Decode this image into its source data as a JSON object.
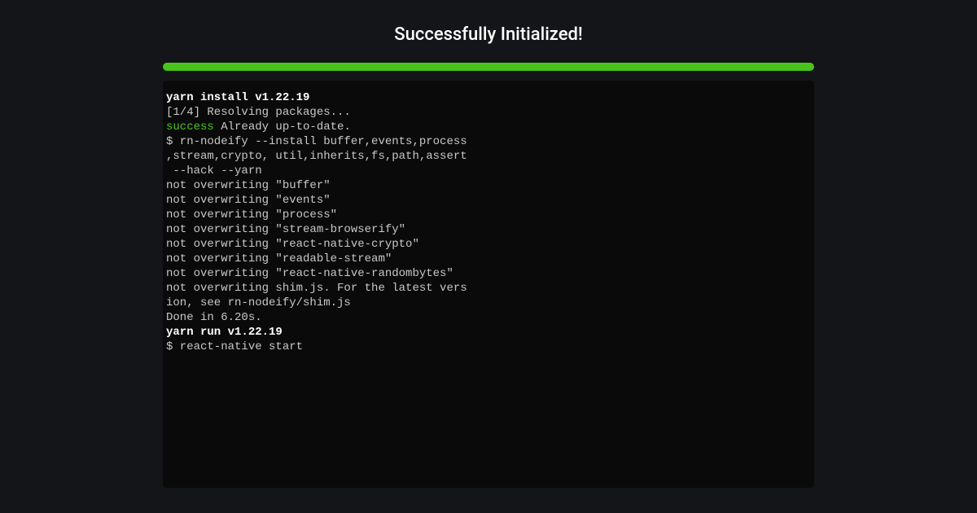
{
  "heading": "Successfully Initialized!",
  "progress": {
    "percent": 100,
    "color": "#4ac41c"
  },
  "terminal": {
    "lines": [
      {
        "segments": [
          {
            "text": "yarn install v1.22.19",
            "style": "bold"
          }
        ]
      },
      {
        "segments": [
          {
            "text": "[1/4] Resolving packages...",
            "style": ""
          }
        ]
      },
      {
        "segments": [
          {
            "text": "success",
            "style": "success"
          },
          {
            "text": " Already up-to-date.",
            "style": ""
          }
        ]
      },
      {
        "segments": [
          {
            "text": "$ rn-nodeify --install buffer,events,process",
            "style": ""
          }
        ]
      },
      {
        "segments": [
          {
            "text": ",stream,crypto, util,inherits,fs,path,assert",
            "style": ""
          }
        ]
      },
      {
        "segments": [
          {
            "text": " --hack --yarn",
            "style": ""
          }
        ]
      },
      {
        "segments": [
          {
            "text": "not overwriting \"buffer\"",
            "style": ""
          }
        ]
      },
      {
        "segments": [
          {
            "text": "not overwriting \"events\"",
            "style": ""
          }
        ]
      },
      {
        "segments": [
          {
            "text": "not overwriting \"process\"",
            "style": ""
          }
        ]
      },
      {
        "segments": [
          {
            "text": "not overwriting \"stream-browserify\"",
            "style": ""
          }
        ]
      },
      {
        "segments": [
          {
            "text": "not overwriting \"react-native-crypto\"",
            "style": ""
          }
        ]
      },
      {
        "segments": [
          {
            "text": "not overwriting \"readable-stream\"",
            "style": ""
          }
        ]
      },
      {
        "segments": [
          {
            "text": "not overwriting \"react-native-randombytes\"",
            "style": ""
          }
        ]
      },
      {
        "segments": [
          {
            "text": "not overwriting shim.js. For the latest vers",
            "style": ""
          }
        ]
      },
      {
        "segments": [
          {
            "text": "ion, see rn-nodeify/shim.js",
            "style": ""
          }
        ]
      },
      {
        "segments": [
          {
            "text": "Done in 6.20s.",
            "style": ""
          }
        ]
      },
      {
        "segments": [
          {
            "text": "yarn run v1.22.19",
            "style": "bold"
          }
        ]
      },
      {
        "segments": [
          {
            "text": "$ react-native start",
            "style": ""
          }
        ]
      }
    ]
  }
}
